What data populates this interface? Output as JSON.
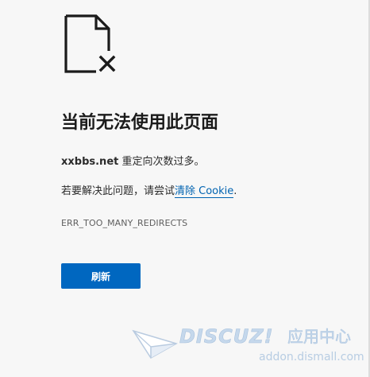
{
  "error_page": {
    "title": "当前无法使用此页面",
    "domain": "xxbbs.net",
    "description_suffix": " 重定向次数过多。",
    "suggestion_prefix": "若要解决此问题，请尝试",
    "suggestion_link": "清除 Cookie",
    "suggestion_suffix": ".",
    "error_code": "ERR_TOO_MANY_REDIRECTS",
    "refresh_label": "刷新",
    "icon": "broken-file-icon"
  },
  "watermark": {
    "brand": "DISCUZ!",
    "cn_label": "应用中心",
    "url": "addon.dismall.com"
  },
  "colors": {
    "background": "#f7f7f7",
    "accent": "#0067c0",
    "link": "#0063b1"
  }
}
